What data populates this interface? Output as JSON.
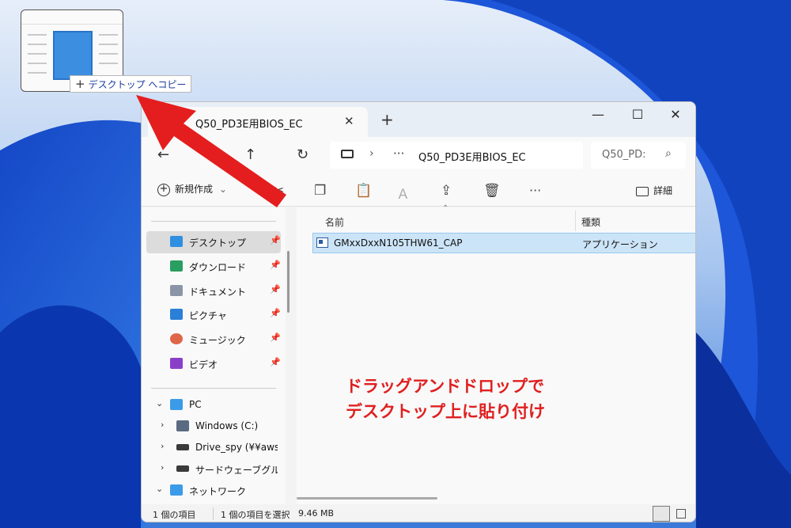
{
  "drag": {
    "tooltip_plus": "+",
    "tooltip_label": "デスクトップ へコピー"
  },
  "window": {
    "tab_title": "Q50_PD3E用BIOS_EC",
    "tab_close": "✕",
    "new_tab": "+",
    "minimize": "—",
    "maximize": "☐",
    "close": "✕"
  },
  "address": {
    "back": "←",
    "forward": "→",
    "up": "↑",
    "refresh": "↻",
    "separator": "›",
    "more": "···",
    "path": "Q50_PD3E用BIOS_EC",
    "search_placeholder": "Q50_PD:",
    "search_icon": "⌕"
  },
  "toolbar": {
    "new_label": "新規作成",
    "new_chevron": "⌄",
    "more": "···",
    "details_label": "詳細"
  },
  "sidebar": {
    "items": [
      {
        "label": "デスクトップ",
        "icon": "desktop-icon",
        "color": "#2f8fe0",
        "pinned": true
      },
      {
        "label": "ダウンロード",
        "icon": "download-icon",
        "color": "#2a9d60",
        "pinned": true
      },
      {
        "label": "ドキュメント",
        "icon": "document-icon",
        "color": "#8a96a8",
        "pinned": true
      },
      {
        "label": "ピクチャ",
        "icon": "pictures-icon",
        "color": "#2b7fd6",
        "pinned": true
      },
      {
        "label": "ミュージック",
        "icon": "music-icon",
        "color": "#e0664a",
        "pinned": true
      },
      {
        "label": "ビデオ",
        "icon": "video-icon",
        "color": "#8a3fc9",
        "pinned": true
      }
    ],
    "pin_glyph": "📌",
    "pc_label": "PC",
    "drives": [
      {
        "label": "Windows (C:)"
      },
      {
        "label": "Drive_spy (¥¥aws-tw"
      },
      {
        "label": "サードウェーブグループ (¥"
      }
    ],
    "network_label": "ネットワーク",
    "chev_open": "⌄",
    "chev_closed": "›"
  },
  "filelist": {
    "col_name": "名前",
    "col_type": "種類",
    "sort_glyph": "⌃",
    "files": [
      {
        "name": "GMxxDxxN105THW61_CAP",
        "type": "アプリケーション"
      }
    ],
    "annotation_line1": "ドラッグアンドドロップで",
    "annotation_line2": "デスクトップ上に貼り付け"
  },
  "status": {
    "count": "1 個の項目",
    "selected": "1 個の項目を選択",
    "size": "9.46 MB"
  }
}
